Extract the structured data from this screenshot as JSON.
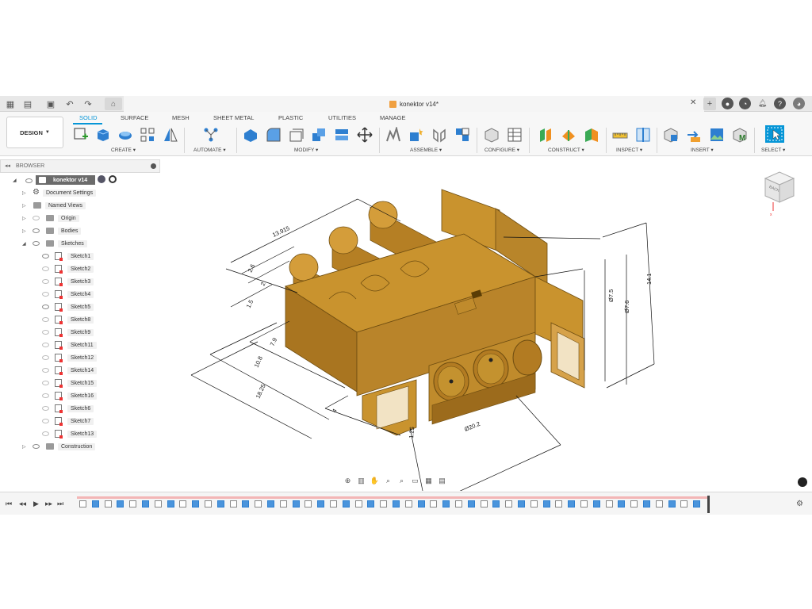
{
  "window": {
    "document_title": "konektor v14*"
  },
  "toolbar": {
    "workspace": "DESIGN",
    "tabs": [
      "SOLID",
      "SURFACE",
      "MESH",
      "SHEET METAL",
      "PLASTIC",
      "UTILITIES",
      "MANAGE"
    ],
    "groups": [
      "CREATE",
      "AUTOMATE",
      "MODIFY",
      "ASSEMBLE",
      "CONFIGURE",
      "CONSTRUCT",
      "INSPECT",
      "INSERT",
      "SELECT"
    ]
  },
  "browser": {
    "title": "BROWSER",
    "root": "konektor v14",
    "nodes": [
      "Document Settings",
      "Named Views",
      "Origin",
      "Bodies",
      "Sketches",
      "Construction"
    ],
    "sketches": [
      "Sketch1",
      "Sketch2",
      "Sketch3",
      "Sketch4",
      "Sketch5",
      "Sketch8",
      "Sketch9",
      "Sketch11",
      "Sketch12",
      "Sketch14",
      "Sketch15",
      "Sketch16",
      "Sketch6",
      "Sketch7",
      "Sketch13"
    ]
  },
  "viewcube": {
    "face": "BACK"
  },
  "dimensions": {
    "d1": "13.915",
    "d2": "2.6",
    "d3": "2",
    "d4": "1.5",
    "d5": "7.9",
    "d6": "10.8",
    "d7": "18.25",
    "d8": "1.25",
    "d9": "Ø20.2",
    "d10": "14.1",
    "d11": "Ø7.6",
    "d12": "Ø7.5",
    "d13": "4"
  },
  "colors": {
    "accent": "#0696d7",
    "model": "#c9932e",
    "model_dark": "#8a6010",
    "timeline_track": "#f3b6b6"
  }
}
